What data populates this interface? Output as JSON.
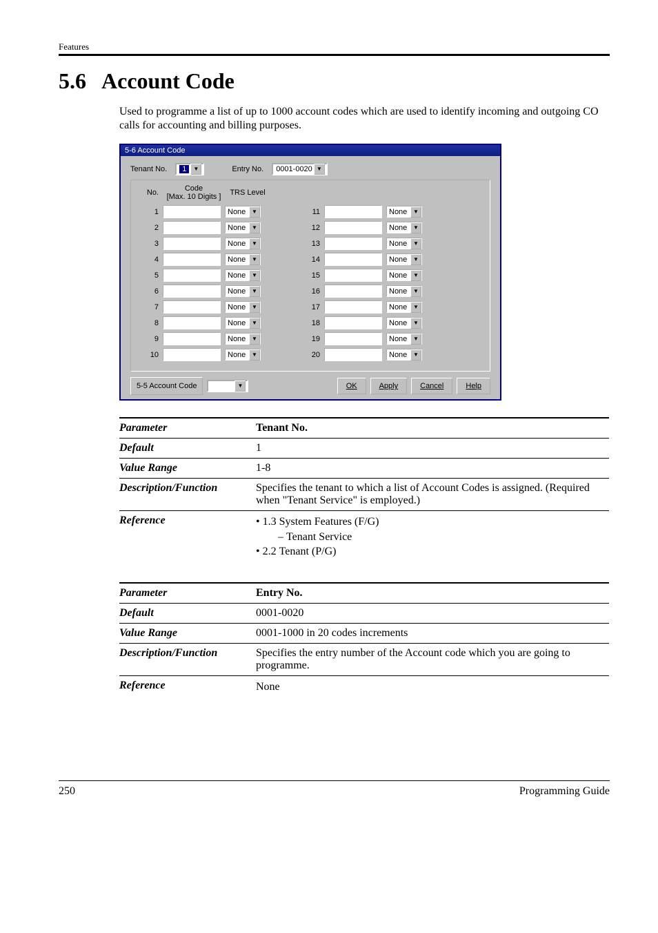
{
  "header": {
    "running": "Features"
  },
  "section": {
    "num": "5.6",
    "title": "Account Code"
  },
  "intro": "Used to programme a list of up to 1000 account codes which are used to identify incoming and outgoing CO calls for accounting and billing purposes.",
  "win": {
    "title": "5-6 Account Code",
    "tenant_label": "Tenant No.",
    "tenant_value": "1",
    "entry_label": "Entry No.",
    "entry_value": "0001-0020",
    "col_no": "No.",
    "col_code": "Code",
    "col_code_sub": "[Max. 10 Digits ]",
    "col_trs": "TRS Level",
    "trs_value": "None",
    "rows_left": [
      "1",
      "2",
      "3",
      "4",
      "5",
      "6",
      "7",
      "8",
      "9",
      "10"
    ],
    "rows_right": [
      "11",
      "12",
      "13",
      "14",
      "15",
      "16",
      "17",
      "18",
      "19",
      "20"
    ],
    "tab": "5-5 Account Code",
    "buttons": {
      "ok": "OK",
      "apply": "Apply",
      "cancel": "Cancel",
      "help": "Help"
    }
  },
  "params": [
    {
      "name": "Tenant No.",
      "rows": {
        "Default": "1",
        "Value Range": "1-8",
        "Description/Function": "Specifies the tenant to which a list of Account Codes is assigned. (Required when \"Tenant Service\" is employed.)",
        "Reference": [
          "• 1.3 System Features (F/G)",
          "        – Tenant Service",
          "• 2.2 Tenant (P/G)"
        ]
      }
    },
    {
      "name": "Entry No.",
      "rows": {
        "Default": "0001-0020",
        "Value Range": "0001-1000 in 20 codes increments",
        "Description/Function": "Specifies the entry number of the Account code which you are going to programme.",
        "Reference": [
          "None"
        ]
      }
    }
  ],
  "footer": {
    "page": "250",
    "book": "Programming Guide"
  }
}
